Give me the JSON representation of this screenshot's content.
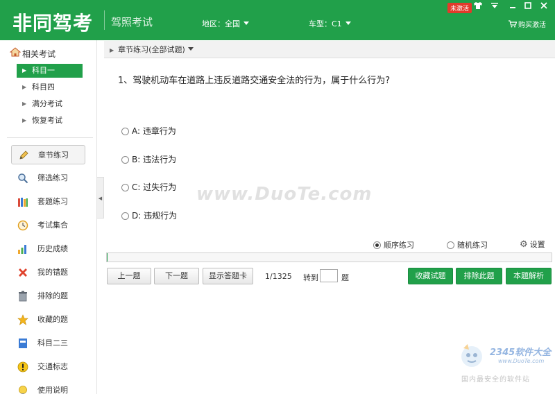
{
  "header": {
    "logo": "非同驾考",
    "subtitle": "驾照考试",
    "region_label": "地区：全国",
    "car_label": "车型：C1",
    "activation_badge": "未激活",
    "buy_label": "购买激活",
    "brand_color": "#21a04a"
  },
  "window_controls": {
    "skin_icon": "shirt-icon",
    "menu_icon": "menu-icon",
    "minimize_icon": "minimize-icon",
    "maximize_icon": "maximize-icon",
    "close_icon": "close-icon"
  },
  "sidebar": {
    "section_title": "相关考试",
    "sub_items": [
      {
        "label": "科目一",
        "active": true
      },
      {
        "label": "科目四",
        "active": false
      },
      {
        "label": "满分考试",
        "active": false
      },
      {
        "label": "恢复考试",
        "active": false
      }
    ],
    "items": [
      {
        "label": "章节练习",
        "icon": "pencil-icon",
        "active": true
      },
      {
        "label": "筛选练习",
        "icon": "magnifier-icon",
        "active": false
      },
      {
        "label": "套题练习",
        "icon": "books-icon",
        "active": false
      },
      {
        "label": "考试集合",
        "icon": "clock-icon",
        "active": false
      },
      {
        "label": "历史成绩",
        "icon": "bar-chart-icon",
        "active": false
      },
      {
        "label": "我的错题",
        "icon": "cross-icon",
        "active": false
      },
      {
        "label": "排除的题",
        "icon": "trash-icon",
        "active": false
      },
      {
        "label": "收藏的题",
        "icon": "star-icon",
        "active": false
      },
      {
        "label": "科目二三",
        "icon": "book-icon",
        "active": false
      },
      {
        "label": "交通标志",
        "icon": "warning-icon",
        "active": false
      },
      {
        "label": "使用说明",
        "icon": "bulb-icon",
        "active": false
      }
    ]
  },
  "breadcrumb": {
    "label": "章节练习(全部试题)"
  },
  "question": {
    "text": "1、驾驶机动车在道路上违反道路交通安全法的行为，属于什么行为?",
    "options": [
      {
        "label": "A: 违章行为"
      },
      {
        "label": "B: 违法行为"
      },
      {
        "label": "C: 过失行为"
      },
      {
        "label": "D: 违规行为"
      }
    ]
  },
  "mode": {
    "sequential_label": "顺序练习",
    "random_label": "随机练习",
    "selected": "sequential",
    "settings_label": "设置"
  },
  "progress": {
    "current": 1,
    "total": 1325
  },
  "nav": {
    "prev_label": "上一题",
    "next_label": "下一题",
    "card_label": "显示答题卡",
    "counter": "1/1325",
    "goto_label": "转到",
    "goto_value": "",
    "goto_suffix": "题",
    "favorite_label": "收藏试题",
    "exclude_label": "排除此题",
    "explain_label": "本题解析"
  },
  "watermarks": {
    "main": "www.DuoTe.com",
    "brand": "2345软件大全",
    "url": "www.DuoTe.com",
    "cn": "国内最安全的软件站"
  }
}
